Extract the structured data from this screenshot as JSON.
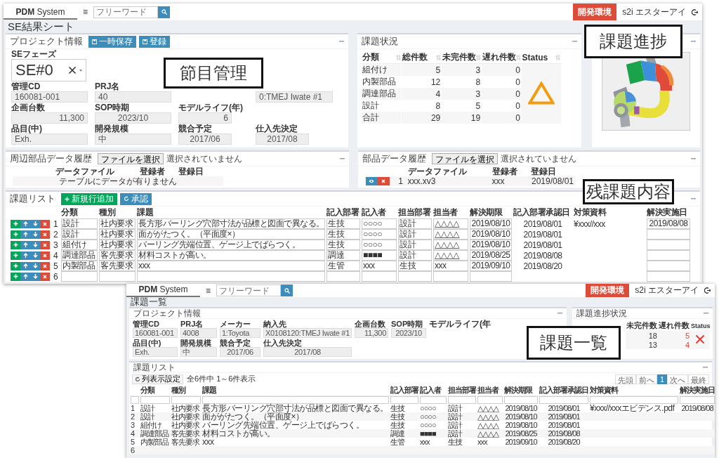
{
  "main_window": {
    "header": {
      "brand": "**PDM** System",
      "menu_icon": "≡",
      "search_placeholder": "フリーワード",
      "env_button": "開発環境",
      "user": "s2i エスターアイ"
    },
    "title": "SE結果シート",
    "project_panel": {
      "title": "プロジェクト情報",
      "buttons": [
        "一時保存",
        "登録"
      ],
      "phase_label": "SEフェーズ",
      "phase_value": "SE#0",
      "rows": [
        [
          {
            "kind": "field",
            "label": "管理CD",
            "value": "160081-001"
          },
          {
            "kind": "field",
            "label": "PRJ名",
            "value": "40"
          },
          {
            "kind": "empty"
          },
          {
            "kind": "covered",
            "value": "0:TMEJ Iwate #1"
          }
        ],
        [
          {
            "kind": "field",
            "label": "企画台数",
            "value": "11,300"
          },
          {
            "kind": "field",
            "label": "SOP時期",
            "value": "2023/10"
          },
          {
            "kind": "field",
            "label": "モデルライフ(年)",
            "value": "6"
          }
        ],
        [
          {
            "kind": "field",
            "label": "品目(中)",
            "value": "Exh."
          },
          {
            "kind": "field",
            "label": "開発規模",
            "value": "中"
          },
          {
            "kind": "field",
            "label": "競合予定",
            "value": "2017/06"
          },
          {
            "kind": "field",
            "label": "仕入先決定",
            "value": "2017/08"
          }
        ]
      ]
    },
    "status_panel": {
      "title": "課題状況",
      "columns": [
        "分類",
        "総件数",
        "未完件数",
        "遅れ件数",
        "Status"
      ],
      "status": {
        "kind": "triangle"
      },
      "rows": [
        [
          "組付け",
          "5",
          "3",
          "0"
        ],
        [
          "内製部品",
          "12",
          "8",
          "0"
        ],
        [
          "調達部品",
          "4",
          "3",
          "0"
        ],
        [
          "設計",
          "8",
          "5",
          "0"
        ],
        [
          "合計",
          "29",
          "19",
          "0"
        ]
      ]
    },
    "peripheral_panel": {
      "title": "周辺部品データ履歴",
      "file_button": "ファイルを選択",
      "file_status": "選択されていません",
      "columns": [
        "データファイル",
        "登録者",
        "登録日"
      ],
      "empty_message": "テーブルにデータが有りません"
    },
    "parts_panel": {
      "title": "部品データ履歴",
      "file_button": "ファイルを選択",
      "file_status": "選択されていません",
      "columns": [
        "データファイル",
        "登録者",
        "登録日"
      ],
      "rows": [
        {
          "no": "1",
          "cells": [
            "xxx.xv3",
            "xxx",
            "2019/08/01"
          ]
        }
      ]
    },
    "issue_panel": {
      "title": "課題リスト",
      "buttons": [
        {
          "label": "新規行追加",
          "kind": "add"
        },
        {
          "label": "承認",
          "kind": "approve"
        }
      ],
      "columns": [
        {
          "label": "分類",
          "kind": "input"
        },
        {
          "label": "種別",
          "kind": "input"
        },
        {
          "label": "課題",
          "kind": "input"
        },
        {
          "label": "記入部署",
          "kind": "input"
        },
        {
          "label": "記入者",
          "kind": "input"
        },
        {
          "label": "担当部署",
          "kind": "input"
        },
        {
          "label": "担当者",
          "kind": "input"
        },
        {
          "label": "解決期限",
          "kind": "input"
        },
        {
          "label": "記入部署承認日",
          "kind": "text"
        },
        {
          "label": "対策資料",
          "kind": "text"
        },
        {
          "label": "解決実施日",
          "kind": "input"
        }
      ],
      "rows": [
        {
          "no": "1",
          "cells": [
            "設計",
            "社内要求",
            "長方形バーリング穴部寸法が品標と図面で異なる。",
            "生技",
            "○○○○",
            "設計",
            "△△△△",
            "2019/08/10",
            "2019/08/01",
            "¥xxx//xxx",
            "2019/08/08"
          ]
        },
        {
          "no": "2",
          "cells": [
            "設計",
            "社内要求",
            "面ががたつく。（平面度×）",
            "生技",
            "○○○○",
            "設計",
            "△△△△",
            "2019/08/10",
            "2019/08/01"
          ]
        },
        {
          "no": "3",
          "cells": [
            "組付け",
            "社内要求",
            "バーリング先端位置、ゲージ上でばらつく。",
            "生技",
            "○○○○",
            "設計",
            "△△△△",
            "2019/08/10",
            "2019/08/01"
          ]
        },
        {
          "no": "4",
          "cells": [
            "調達部品",
            "客先要求",
            "材料コストが高い。",
            "調達",
            "■■■■",
            "設計",
            "△△△△",
            "2019/08/25",
            "2019/08/08"
          ]
        },
        {
          "no": "5",
          "cells": [
            "内製部品",
            "客先要求",
            "xxx",
            "生管",
            "xxx",
            "生技",
            "xxx",
            "2019/09/10",
            "2019/08/20"
          ]
        },
        {
          "no": "6"
        }
      ]
    }
  },
  "list_window": {
    "header": {
      "brand": "**PDM** System",
      "menu_icon": "≡",
      "search_placeholder": "フリーワード",
      "env_button": "開発環境",
      "user": "s2i エスターアイ"
    },
    "title": "課題一覧",
    "project_panel": {
      "title": "プロジェクト情報",
      "rows": [
        [
          {
            "kind": "field",
            "label": "管理CD",
            "value": "160081-001"
          },
          {
            "kind": "field",
            "label": "PRJ名",
            "value": "4008"
          },
          {
            "kind": "field",
            "label": "メーカー",
            "value": "1:Toyota"
          },
          {
            "kind": "field",
            "label": "納入先",
            "value": "X0108120:TMEJ Iwate #1"
          },
          {
            "kind": "field",
            "label": "企画台数",
            "value": "11,300"
          },
          {
            "kind": "field",
            "label": "SOP時期",
            "value": "2023/10"
          },
          {
            "kind": "label_only",
            "label": "モデルライフ(年"
          }
        ],
        [
          {
            "kind": "field",
            "label": "品目(中)",
            "value": "Exh."
          },
          {
            "kind": "field",
            "label": "開発規模",
            "value": "中"
          },
          {
            "kind": "field",
            "label": "競合予定",
            "value": "2017/06"
          },
          {
            "kind": "field",
            "label": "仕入先決定",
            "value": "2017/08"
          }
        ]
      ]
    },
    "progress_panel": {
      "title": "課題進捗状況",
      "columns": [
        "未完件数",
        "遅れ件数",
        "Status"
      ],
      "status": {
        "kind": "cross"
      },
      "rows": [
        [
          "18",
          "5"
        ],
        [
          "13",
          "4"
        ]
      ]
    },
    "issue_panel": {
      "title": "課題リスト",
      "settings_button": "列表示設定",
      "count": "全6件中 1～6件表示",
      "pagination": [
        {
          "label": "先頭",
          "selected": false
        },
        {
          "label": "前へ",
          "selected": false
        },
        {
          "label": "1",
          "selected": true
        },
        {
          "label": "次へ",
          "selected": false
        },
        {
          "label": "最終",
          "selected": false
        }
      ],
      "columns": [
        "分類",
        "種別",
        "課題",
        "記入部署",
        "記入者",
        "担当部署",
        "担当者",
        "解決期限",
        "記入部署承認日",
        "対策資料",
        "解決実施日"
      ],
      "rows": [
        {
          "no": "1",
          "cells": [
            "設計",
            "社内要求",
            "長方形バーリング穴部寸法が品標と図面で異なる。",
            "生技",
            "○○○○",
            "設計",
            "△△△△",
            "2019/08/10",
            "2019/08/01",
            "¥xxx//xxxエビデンス.pdf",
            "2019/08/08"
          ]
        },
        {
          "no": "2",
          "cells": [
            "設計",
            "社内要求",
            "面ががたつく。（平面度×）",
            "生技",
            "○○○○",
            "設計",
            "△△△△",
            "2019/08/10",
            "2019/08/01"
          ]
        },
        {
          "no": "3",
          "cells": [
            "組付け",
            "社内要求",
            "バーリング先端位置、ゲージ上でばらつく。",
            "生技",
            "○○○○",
            "設計",
            "△△△△",
            "2019/08/10",
            "2019/08/01"
          ]
        },
        {
          "no": "4",
          "cells": [
            "調達部品",
            "客先要求",
            "材料コストが高い。",
            "調達",
            "■■■■",
            "設計",
            "△△△△",
            "2019/08/25",
            "2019/08/08"
          ]
        },
        {
          "no": "5",
          "cells": [
            "内製部品",
            "客先要求",
            "xxx",
            "生管",
            "xxx",
            "生技",
            "xxx",
            "2019/09/10",
            "2019/08/20"
          ]
        },
        {
          "no": "6"
        }
      ]
    }
  },
  "callouts": [
    {
      "text": "節目管理"
    },
    {
      "text": "課題進捗"
    },
    {
      "text": "残課題内容"
    },
    {
      "text": "課題一覧"
    }
  ]
}
